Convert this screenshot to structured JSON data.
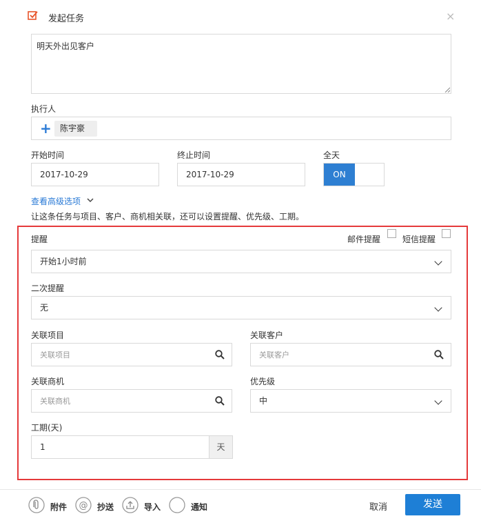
{
  "dialog": {
    "title": "发起任务",
    "close": "×"
  },
  "task": {
    "content": "明天外出见客户"
  },
  "executor": {
    "label": "执行人",
    "add": "+",
    "assignee": "陈宇豪"
  },
  "time": {
    "start_label": "开始时间",
    "start_value": "2017-10-29",
    "end_label": "终止时间",
    "end_value": "2017-10-29",
    "allday_label": "全天",
    "allday_toggle": "ON"
  },
  "advanced": {
    "link": "查看高级选项",
    "description": "让这条任务与项目、客户、商机相关联，还可以设置提醒、优先级、工期。"
  },
  "reminder": {
    "label": "提醒",
    "email": "邮件提醒",
    "sms": "短信提醒",
    "value": "开始1小时前",
    "second_label": "二次提醒",
    "second_value": "无"
  },
  "relations": {
    "project_label": "关联项目",
    "project_placeholder": "关联项目",
    "customer_label": "关联客户",
    "customer_placeholder": "关联客户",
    "opportunity_label": "关联商机",
    "opportunity_placeholder": "关联商机",
    "priority_label": "优先级",
    "priority_value": "中"
  },
  "duration": {
    "label": "工期(天)",
    "value": "1",
    "unit": "天"
  },
  "footer": {
    "attach": "附件",
    "cc": "抄送",
    "import": "导入",
    "notify": "通知",
    "cancel": "取消",
    "send": "发送"
  },
  "colors": {
    "accent": "#1e7fd6",
    "highlight_border": "#e5393a",
    "title_icon": "#e8542a"
  }
}
